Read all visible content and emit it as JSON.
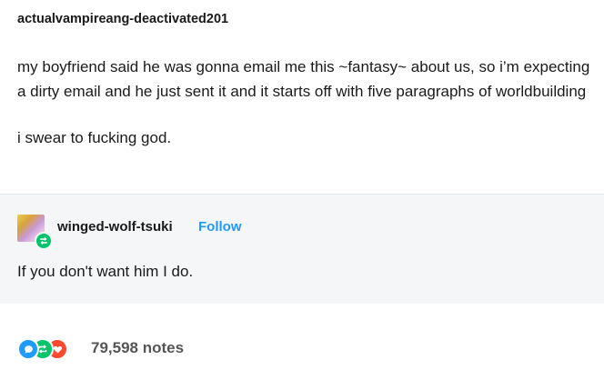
{
  "original_post": {
    "username": "actualvampireang-deactivated201",
    "paragraphs": [
      "my boyfriend said he was gonna email me this ~fantasy~ about us, so i’m expecting a dirty email and he just sent it and it starts off with five paragraphs of worldbuilding",
      "i swear to fucking god."
    ]
  },
  "reblog": {
    "username": "winged-wolf-tsuki",
    "follow_label": "Follow",
    "body": "If you don't want him I do."
  },
  "footer": {
    "notes_label": "79,598 notes",
    "colors": {
      "reply": "#1f9aff",
      "reblog": "#00c46a",
      "like": "#ff4930"
    }
  }
}
